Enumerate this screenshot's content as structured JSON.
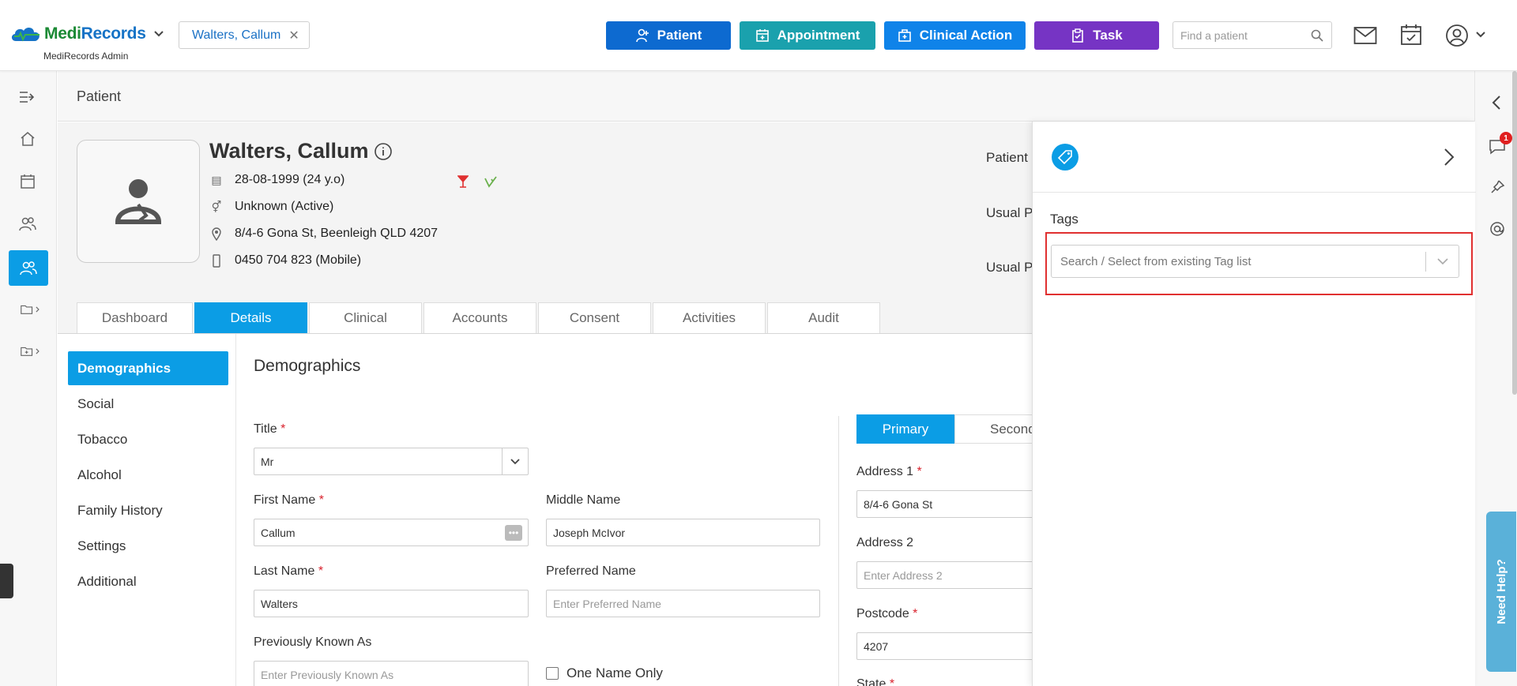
{
  "app": {
    "brand_main": "Medi",
    "brand_accent": "Records",
    "brand_sub": "MediRecords Admin"
  },
  "header": {
    "patient_chip": "Walters, Callum",
    "buttons": {
      "patient": "Patient",
      "appointment": "Appointment",
      "clinical_action": "Clinical Action",
      "task": "Task"
    },
    "search_placeholder": "Find a patient"
  },
  "page": {
    "title": "Patient"
  },
  "patient": {
    "name": "Walters, Callum",
    "dob": "28-08-1999 (24 y.o)",
    "gender": "Unknown (Active)",
    "address": "8/4-6 Gona St, Beenleigh QLD 4207",
    "phone": "0450 704 823 (Mobile)"
  },
  "tabs": [
    "Dashboard",
    "Details",
    "Clinical",
    "Accounts",
    "Consent",
    "Activities",
    "Audit"
  ],
  "side_menu": [
    "Demographics",
    "Social",
    "Tobacco",
    "Alcohol",
    "Family History",
    "Settings",
    "Additional"
  ],
  "demographics": {
    "title": "Demographics",
    "title_label": "Title",
    "title_value": "Mr",
    "first_name_label": "First Name",
    "first_name_value": "Callum",
    "middle_name_label": "Middle Name",
    "middle_name_value": "Joseph McIvor",
    "last_name_label": "Last Name",
    "last_name_value": "Walters",
    "preferred_name_label": "Preferred Name",
    "preferred_name_placeholder": "Enter Preferred Name",
    "prev_known_label": "Previously Known As",
    "prev_known_placeholder": "Enter Previously Known As",
    "one_name_only": "One Name Only",
    "required_mark": "*"
  },
  "address_tabs": {
    "primary": "Primary",
    "secondary": "Second"
  },
  "address": {
    "address1_label": "Address 1",
    "address1_value": "8/4-6 Gona St",
    "address2_label": "Address 2",
    "address2_placeholder": "Enter Address 2",
    "postcode_label": "Postcode",
    "postcode_value": "4207",
    "state_label": "State"
  },
  "partial_labels": {
    "patient": "Patient",
    "usual1": "Usual Pr",
    "usual2": "Usual Pr"
  },
  "tags_panel": {
    "label": "Tags",
    "placeholder": "Search / Select from existing Tag list"
  },
  "notifications": {
    "chat_count": "1"
  },
  "help": {
    "label": "Need Help?"
  },
  "colors": {
    "patient_btn": "#0d6ad0",
    "appointment_btn": "#1aa1ad",
    "clinical_btn": "#0f83e9",
    "task_btn": "#7634c4",
    "accent": "#0b9de5",
    "highlight": "#e03030"
  }
}
